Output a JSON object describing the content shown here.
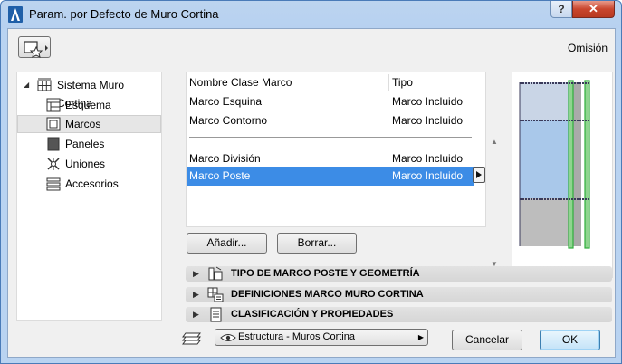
{
  "window": {
    "title": "Param. por Defecto de Muro Cortina",
    "help_label": "?",
    "close_label": "✕"
  },
  "header": {
    "omision_label": "Omisión"
  },
  "tree": {
    "root": {
      "label": "Sistema Muro Cortina",
      "icon": "curtain-wall-icon"
    },
    "items": [
      {
        "label": "Esquema",
        "icon": "scheme-icon"
      },
      {
        "label": "Marcos",
        "icon": "frame-icon",
        "selected": true
      },
      {
        "label": "Paneles",
        "icon": "panel-icon"
      },
      {
        "label": "Uniones",
        "icon": "junction-icon"
      },
      {
        "label": "Accesorios",
        "icon": "accessory-icon"
      }
    ]
  },
  "frame_table": {
    "columns": [
      "Nombre Clase Marco",
      "Tipo"
    ],
    "rows": [
      [
        "Marco Esquina",
        "Marco Incluido"
      ],
      [
        "Marco Contorno",
        "Marco Incluido"
      ],
      [
        "Marco División",
        "Marco Incluido"
      ],
      [
        "Marco Poste",
        "Marco Incluido"
      ]
    ],
    "selected_row": 3
  },
  "buttons": {
    "add": "Añadir...",
    "delete": "Borrar...",
    "cancel": "Cancelar",
    "ok": "OK"
  },
  "sections": [
    {
      "title": "TIPO DE MARCO POSTE Y GEOMETRÍA",
      "icon": "frame-geometry-icon"
    },
    {
      "title": "DEFINICIONES MARCO MURO CORTINA",
      "icon": "frame-definitions-icon"
    },
    {
      "title": "CLASIFICACIÓN Y PROPIEDADES",
      "icon": "classification-icon"
    }
  ],
  "layer": {
    "value": "Estructura - Muros Cortina"
  },
  "colors": {
    "selection": "#3c8ce6",
    "preview_glass": "#a9c8ea",
    "preview_mullion": "#2fae3c",
    "preview_panel": "#bdbdbd"
  }
}
